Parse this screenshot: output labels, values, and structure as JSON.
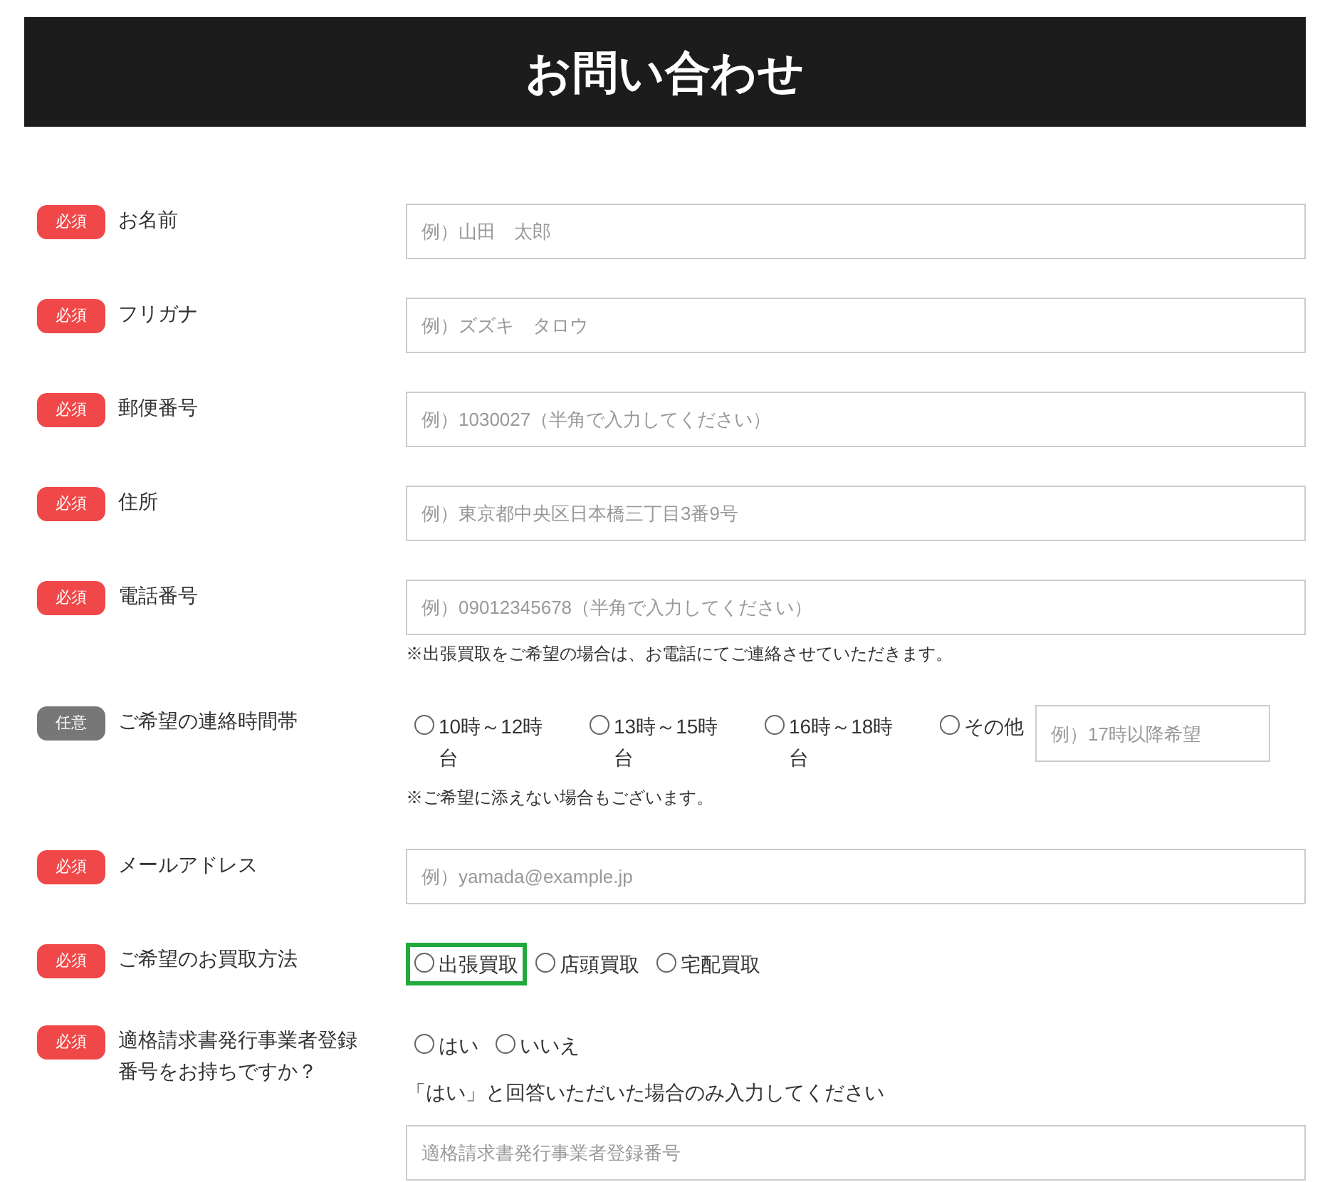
{
  "header": {
    "title": "お問い合わせ"
  },
  "fields": [
    {
      "badge": {
        "kind": "required",
        "text": "必須"
      },
      "label": "お名前",
      "controls": [
        {
          "kind": "input",
          "placeholder": "例）山田　太郎"
        }
      ]
    },
    {
      "badge": {
        "kind": "required",
        "text": "必須"
      },
      "label": "フリガナ",
      "controls": [
        {
          "kind": "input",
          "placeholder": "例）ズズキ　タロウ"
        }
      ]
    },
    {
      "badge": {
        "kind": "required",
        "text": "必須"
      },
      "label": "郵便番号",
      "controls": [
        {
          "kind": "input",
          "placeholder": "例）1030027（半角で入力してください）"
        }
      ]
    },
    {
      "badge": {
        "kind": "required",
        "text": "必須"
      },
      "label": "住所",
      "controls": [
        {
          "kind": "input",
          "placeholder": "例）東京都中央区日本橋三丁目3番9号"
        }
      ]
    },
    {
      "badge": {
        "kind": "required",
        "text": "必須"
      },
      "label": "電話番号",
      "controls": [
        {
          "kind": "input",
          "placeholder": "例）09012345678（半角で入力してください）"
        },
        {
          "kind": "note",
          "text": "※出張買取をご希望の場合は、お電話にてご連絡させていただきます。"
        }
      ]
    },
    {
      "badge": {
        "kind": "optional",
        "text": "任意"
      },
      "label": "ご希望の連絡時間帯",
      "controls": [
        {
          "kind": "radios",
          "options": [
            {
              "label": "10時～12時台",
              "checked": false,
              "highlighted": false
            },
            {
              "label": "13時～15時台",
              "checked": false,
              "highlighted": false
            },
            {
              "label": "16時～18時台",
              "checked": false,
              "highlighted": false
            },
            {
              "label": "その他",
              "checked": false,
              "highlighted": false
            }
          ],
          "other_placeholder": "例）17時以降希望"
        },
        {
          "kind": "note",
          "text": "※ご希望に添えない場合もございます。"
        }
      ]
    },
    {
      "badge": {
        "kind": "required",
        "text": "必須"
      },
      "label": "メールアドレス",
      "controls": [
        {
          "kind": "input",
          "placeholder": "例）yamada@example.jp"
        }
      ]
    },
    {
      "badge": {
        "kind": "required",
        "text": "必須"
      },
      "label": "ご希望のお買取方法",
      "controls": [
        {
          "kind": "radios",
          "options": [
            {
              "label": "出張買取",
              "checked": false,
              "highlighted": true
            },
            {
              "label": "店頭買取",
              "checked": false,
              "highlighted": false
            },
            {
              "label": "宅配買取",
              "checked": false,
              "highlighted": false
            }
          ]
        }
      ]
    },
    {
      "badge": {
        "kind": "required",
        "text": "必須"
      },
      "label": "適格請求書発行事業者登録番号をお持ちですか？",
      "controls": [
        {
          "kind": "radios",
          "options": [
            {
              "label": "はい",
              "checked": false,
              "highlighted": false
            },
            {
              "label": "いいえ",
              "checked": false,
              "highlighted": false
            }
          ]
        },
        {
          "kind": "instruction",
          "text": "「はい」と回答いただいた場合のみ入力してください"
        },
        {
          "kind": "input",
          "placeholder": "適格請求書発行事業者登録番号"
        }
      ]
    }
  ]
}
